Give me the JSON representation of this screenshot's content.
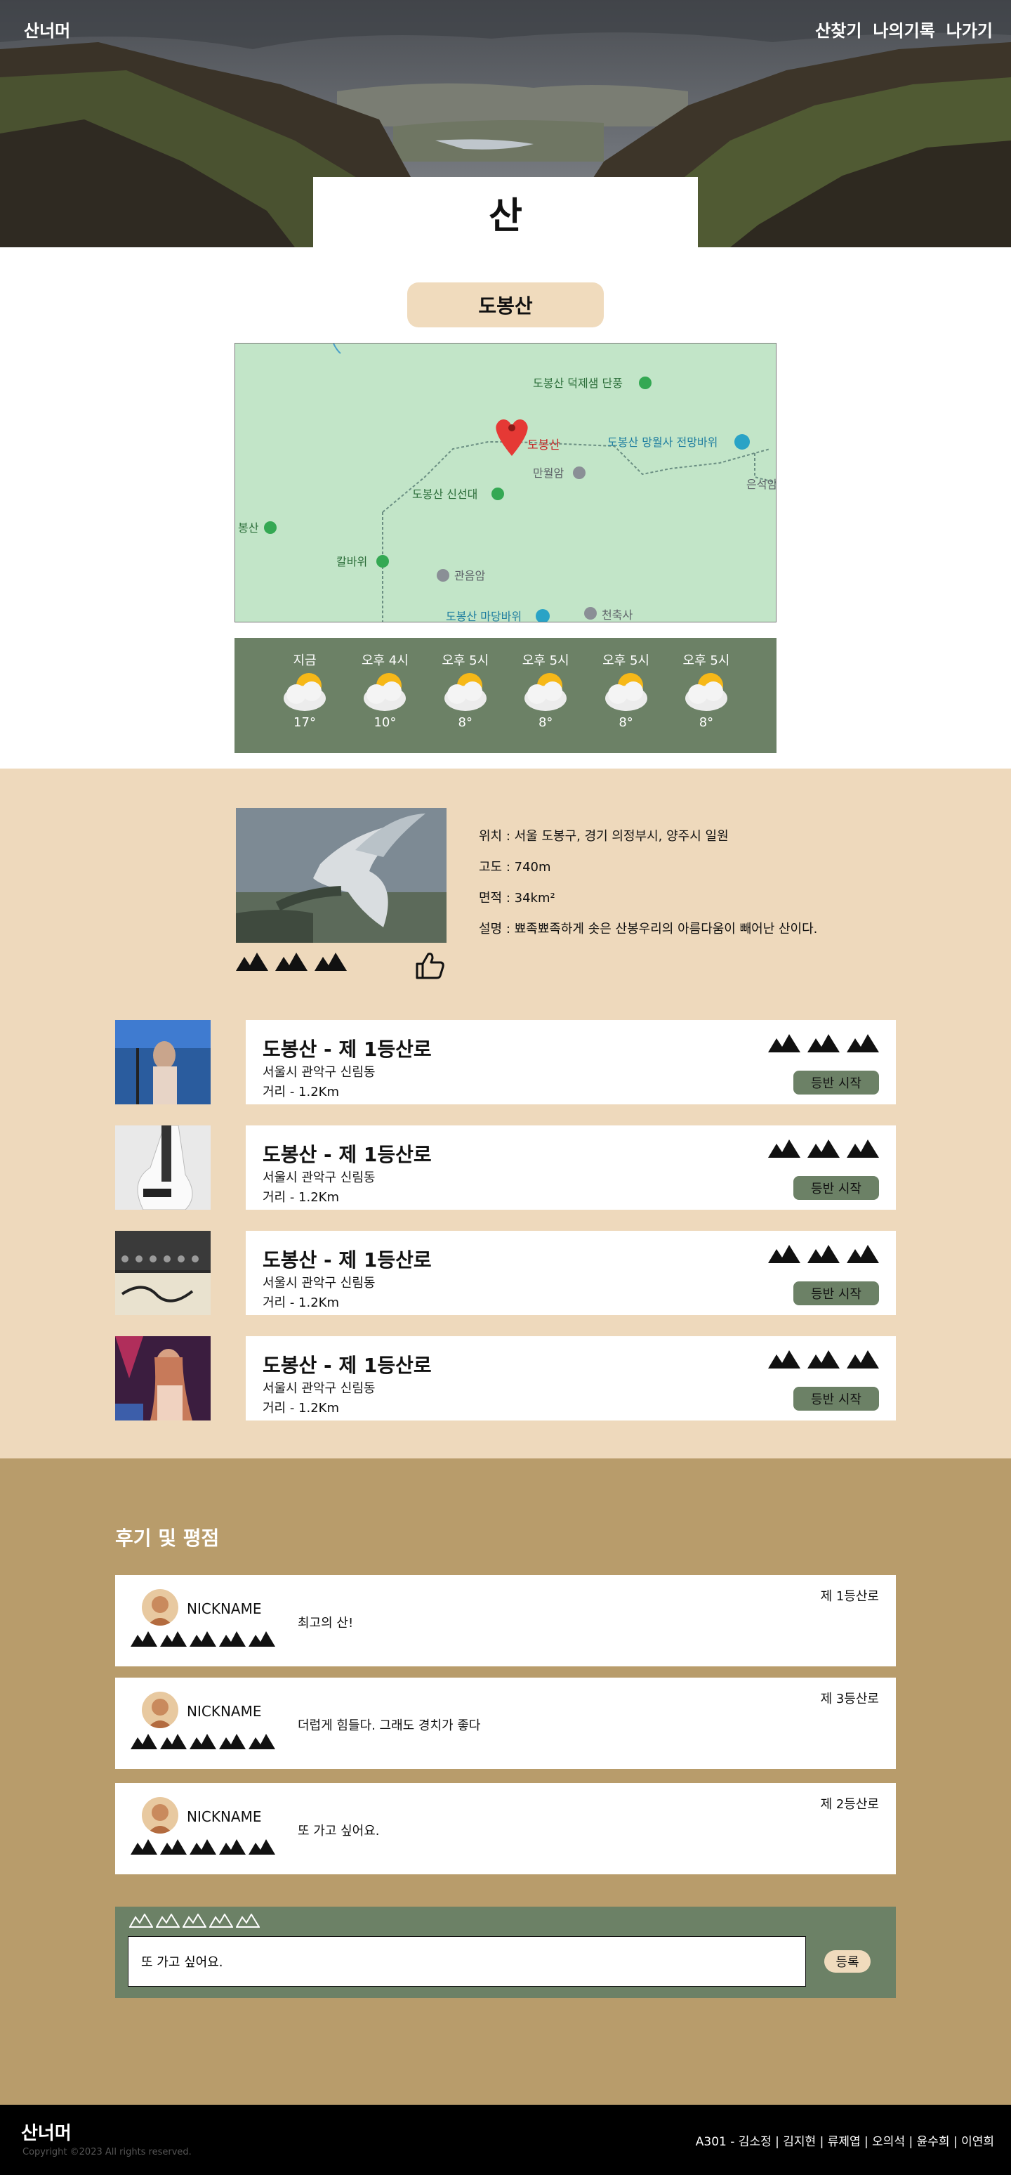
{
  "nav": {
    "brand": "산너머",
    "links": [
      "산찾기",
      "나의기록",
      "나가기"
    ]
  },
  "hero": {
    "title": "산"
  },
  "mountain": {
    "name": "도봉산",
    "map_labels": {
      "deokje": "도봉산 덕제샘 단풍",
      "peak": "도봉산",
      "mangwolsa": "도봉산 망월사 전망바위",
      "manwolam": "만월암",
      "sinseondae": "도봉산 신선대",
      "eunseok": "은석암",
      "bongsan": "봉산",
      "kalbawi": "칼바위",
      "gwaneumam": "관음암",
      "madangbawi": "도봉산 마당바위",
      "cheonchuksa": "천축사"
    }
  },
  "weather": [
    {
      "time": "지금",
      "temp": "17°"
    },
    {
      "time": "오후 4시",
      "temp": "10°"
    },
    {
      "time": "오후 5시",
      "temp": "8°"
    },
    {
      "time": "오후 5시",
      "temp": "8°"
    },
    {
      "time": "오후 5시",
      "temp": "8°"
    },
    {
      "time": "오후 5시",
      "temp": "8°"
    }
  ],
  "info": {
    "location": "위치 : 서울 도봉구, 경기 의정부시, 양주시 일원",
    "altitude": "고도 : 740m",
    "area": "면적 : 34km²",
    "description": "설명 : 뾰족뾰족하게 솟은 산봉우리의 아름다움이 빼어난 산이다.",
    "rating": 3
  },
  "courses": [
    {
      "title": "도봉산 - 제 1등산로",
      "address": "서울시 관악구 신림동",
      "distance": "거리 - 1.2Km",
      "button": "등반 시작",
      "rating": 3
    },
    {
      "title": "도봉산 - 제 1등산로",
      "address": "서울시 관악구 신림동",
      "distance": "거리 - 1.2Km",
      "button": "등반 시작",
      "rating": 3
    },
    {
      "title": "도봉산 - 제 1등산로",
      "address": "서울시 관악구 신림동",
      "distance": "거리 - 1.2Km",
      "button": "등반 시작",
      "rating": 3
    },
    {
      "title": "도봉산 - 제 1등산로",
      "address": "서울시 관악구 신림동",
      "distance": "거리 - 1.2Km",
      "button": "등반 시작",
      "rating": 3
    }
  ],
  "reviews_section": {
    "heading": "후기 및 평점",
    "reviews": [
      {
        "nickname": "NICKNAME",
        "text": "최고의 산!",
        "course": "제 1등산로",
        "rating": 5
      },
      {
        "nickname": "NICKNAME",
        "text": "더럽게 힘들다. 그래도 경치가 좋다",
        "course": "제 3등산로",
        "rating": 5
      },
      {
        "nickname": "NICKNAME",
        "text": "또 가고 싶어요.",
        "course": "제 2등산로",
        "rating": 5
      }
    ],
    "write": {
      "value": "또 가고 싶어요.",
      "button": "등록",
      "rating": 0
    }
  },
  "footer": {
    "brand": "산너머",
    "copyright": "Copyright ©2023 All rights reserved.",
    "team": "A301 - 김소정 | 김지현 | 류제엽 | 오의석 | 윤수희 | 이연희"
  },
  "colors": {
    "beige": "#eed9bc",
    "pill": "#f0dbbd",
    "green": "#6c8166",
    "tan": "#b89c6b",
    "map_green": "#c2e5c8"
  }
}
